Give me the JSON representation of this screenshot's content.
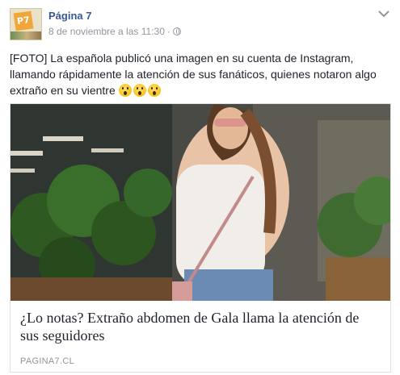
{
  "post": {
    "page_name": "Página 7",
    "timestamp": "8 de noviembre a las 11:30",
    "separator": "·",
    "privacy_icon": "globe-icon",
    "options_icon": "chevron-down-icon",
    "avatar_text": "P7",
    "text": "[FOTO] La española publicó una imagen en su cuenta de Instagram, llamando rápidamente la atención de sus fanáticos, quienes notaron algo extraño en su vientre",
    "emojis": [
      "astonished-face",
      "astonished-face",
      "astonished-face"
    ]
  },
  "link_card": {
    "title": "¿Lo notas? Extraño abdomen de Gala llama la atención de sus seguidores",
    "domain": "PAGINA7.CL"
  },
  "colors": {
    "link_blue": "#365899",
    "meta_gray": "#90949c",
    "text": "#1d2129",
    "border": "#dddfe2"
  }
}
